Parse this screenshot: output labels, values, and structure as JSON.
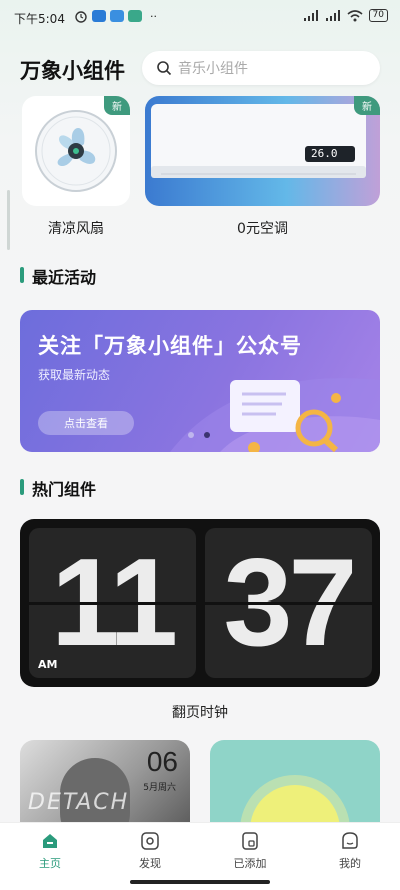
{
  "status": {
    "time": "下午5:04",
    "battery": "70",
    "more": "··"
  },
  "header": {
    "title": "万象小组件",
    "search_placeholder": "音乐小组件"
  },
  "widgets_top": [
    {
      "label": "清凉风扇",
      "badge": "新"
    },
    {
      "label": "0元空调",
      "badge": "新",
      "display_temp": "26.0"
    }
  ],
  "recent": {
    "title": "最近活动",
    "banner_title": "关注「万象小组件」公众号",
    "banner_sub": "获取最新动态",
    "banner_button": "点击查看"
  },
  "popular": {
    "title": "热门组件",
    "clock_hour": "11",
    "clock_minute": "37",
    "clock_ampm": "AM",
    "clock_label": "翻页时钟",
    "photo_day": "06",
    "photo_date": "5月周六",
    "photo_text": "DETACH"
  },
  "nav": [
    {
      "label": "主页",
      "active": true
    },
    {
      "label": "发现"
    },
    {
      "label": "已添加"
    },
    {
      "label": "我的"
    }
  ],
  "colors": {
    "accent": "#2b9b7c",
    "banner": "#7a70de",
    "badge": "#3f9a7e"
  }
}
